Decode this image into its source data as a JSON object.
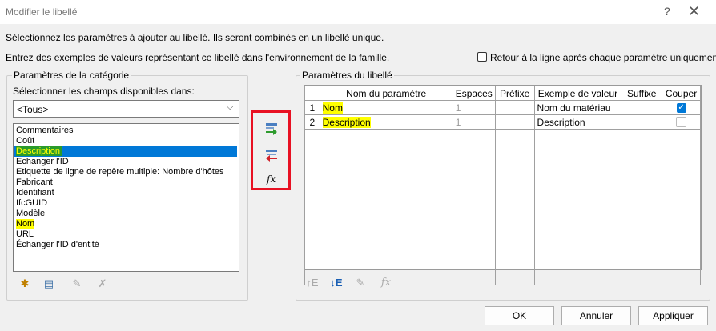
{
  "window": {
    "title": "Modifier le libellé",
    "help": "?",
    "close": "✕"
  },
  "intro": {
    "line1": "Sélectionnez les paramètres à ajouter au libellé. Ils seront combinés en un libellé unique.",
    "line2": "Entrez des exemples de valeurs représentant ce libellé dans l'environnement de la famille."
  },
  "wrap_option": {
    "label": "Retour à la ligne après chaque paramètre uniquement",
    "checked": false
  },
  "category": {
    "legend": "Paramètres de la catégorie",
    "select_label": "Sélectionner les champs disponibles dans:",
    "select_value": "<Tous>",
    "items": [
      "Commentaires",
      "Coût",
      "Description",
      "Echanger l'ID",
      "Etiquette de ligne de repère multiple: Nombre d'hôtes",
      "Fabricant",
      "Identifiant",
      "IfcGUID",
      "Modèle",
      "Nom",
      "URL",
      "Échanger l'ID d'entité"
    ],
    "selected_item": "Description"
  },
  "label_params": {
    "legend": "Paramètres du libellé",
    "columns": [
      "Nom du paramètre",
      "Espaces",
      "Préfixe",
      "Exemple de valeur",
      "Suffixe",
      "Couper"
    ],
    "rows": [
      {
        "num": "1",
        "name": "Nom",
        "spaces": "1",
        "prefix": "",
        "sample": "Nom du matériau",
        "suffix": "",
        "break": true
      },
      {
        "num": "2",
        "name": "Description",
        "spaces": "1",
        "prefix": "",
        "sample": "Description",
        "suffix": "",
        "break": false
      }
    ]
  },
  "colors": {
    "selection": "#0078d7",
    "highlight": "#ffff00",
    "arrow_box": "#e81123"
  },
  "buttons": {
    "ok": "OK",
    "cancel": "Annuler",
    "apply": "Appliquer"
  }
}
